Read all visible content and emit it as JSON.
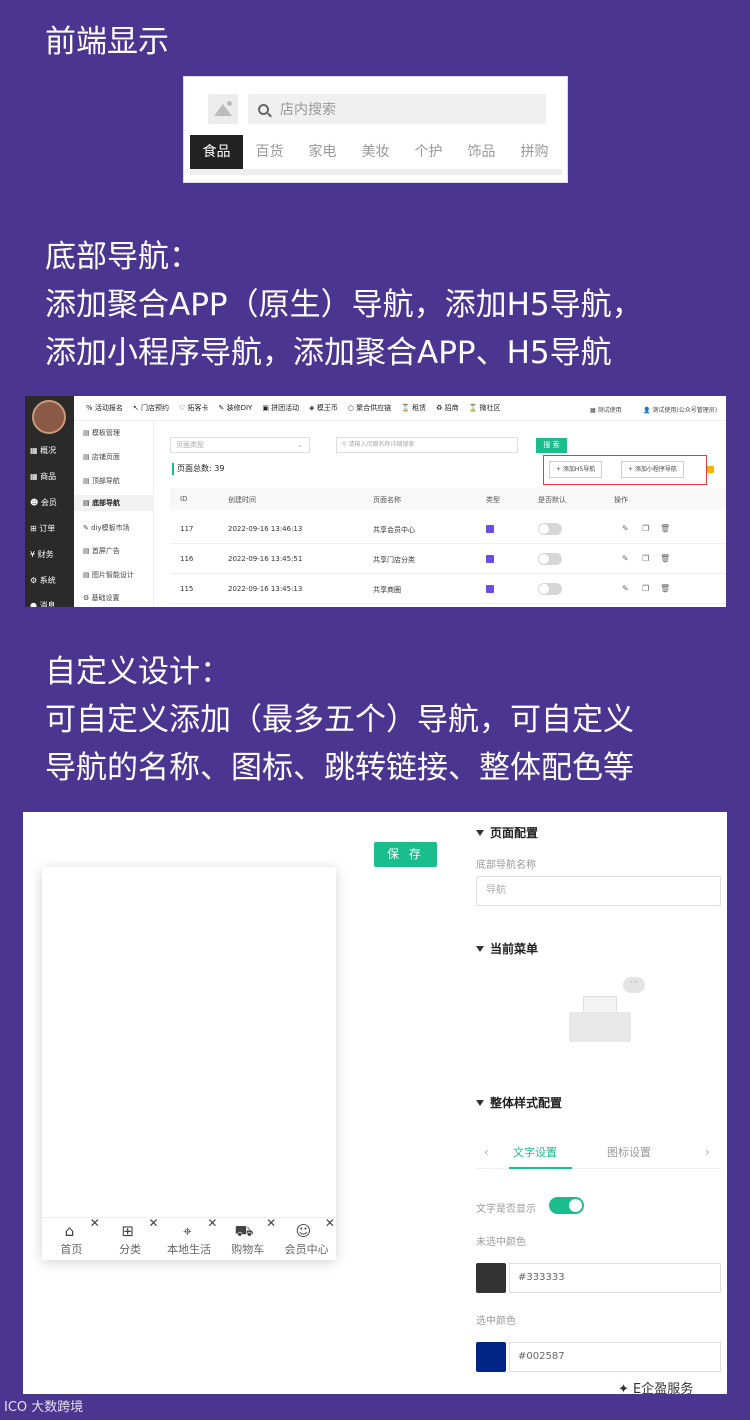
{
  "headings": {
    "h1": [
      "前端显示"
    ],
    "h2": [
      "底部导航：",
      "添加聚合APP（原生）导航，添加H5导航，",
      "添加小程序导航，添加聚合APP、H5导航"
    ],
    "h3": [
      "自定义设计：",
      "可自定义添加（最多五个）导航，可自定义",
      "导航的名称、图标、跳转链接、整体配色等"
    ]
  },
  "frontend": {
    "search_placeholder": "店内搜索",
    "tabs": [
      "食品",
      "百货",
      "家电",
      "美妆",
      "个护",
      "饰品",
      "拼购"
    ]
  },
  "admin": {
    "top_nav": [
      "活动报名",
      "门店预约",
      "拓客卡",
      "装修DIY",
      "拼团活动",
      "模王币",
      "聚合供应链",
      "租赁",
      "招商",
      "微社区"
    ],
    "top_right": [
      "测试使用",
      "测试使用(公众号管理员)"
    ],
    "side_menu": [
      "概况",
      "商品",
      "会员",
      "订单",
      "财务",
      "系统",
      "消息"
    ],
    "sub_menu": [
      "模板管理",
      "店铺页面",
      "顶部导航",
      "底部导航",
      "diy模板市场",
      "首屏广告",
      "图片智能设计",
      "基础设置"
    ],
    "page_type_placeholder": "页面类型",
    "keyword_placeholder": "请输入页面名称详细搜索",
    "search_button": "搜 索",
    "total": "页面总数: 39",
    "add_h5": "+ 添加H5导航",
    "add_mini": "+ 添加小程序导航",
    "columns": [
      "ID",
      "创建时间",
      "页面名称",
      "类型",
      "是否默认",
      "操作"
    ],
    "rows": [
      {
        "id": "117",
        "time": "2022-09-16 13:46:13",
        "name": "共享会员中心"
      },
      {
        "id": "116",
        "time": "2022-09-16 13:45:51",
        "name": "共享门店分类"
      },
      {
        "id": "115",
        "time": "2022-09-16 13:45:13",
        "name": "共享商圈"
      }
    ]
  },
  "designer": {
    "save_button": "保 存",
    "nav_items": [
      {
        "label": "首页",
        "icon": "home-icon"
      },
      {
        "label": "分类",
        "icon": "grid-icon"
      },
      {
        "label": "本地生活",
        "icon": "location-pin-icon"
      },
      {
        "label": "购物车",
        "icon": "cart-icon"
      },
      {
        "label": "会员中心",
        "icon": "user-icon"
      }
    ],
    "page_config_title": "页面配置",
    "nav_name_label": "底部导航名称",
    "nav_name_value": "导航",
    "current_menu_title": "当前菜单",
    "style_config_title": "整体样式配置",
    "tab_text": "文字设置",
    "tab_icon": "图标设置",
    "text_show_label": "文字是否显示",
    "unselected_color_label": "未选中颜色",
    "unselected_color": "#333333",
    "selected_color_label": "选中颜色",
    "selected_color": "#002587"
  },
  "watermarks": {
    "left": "大数跨境",
    "right": "E企盈服务"
  },
  "colors": {
    "background": "#4a3590",
    "accent": "#19be8c"
  }
}
